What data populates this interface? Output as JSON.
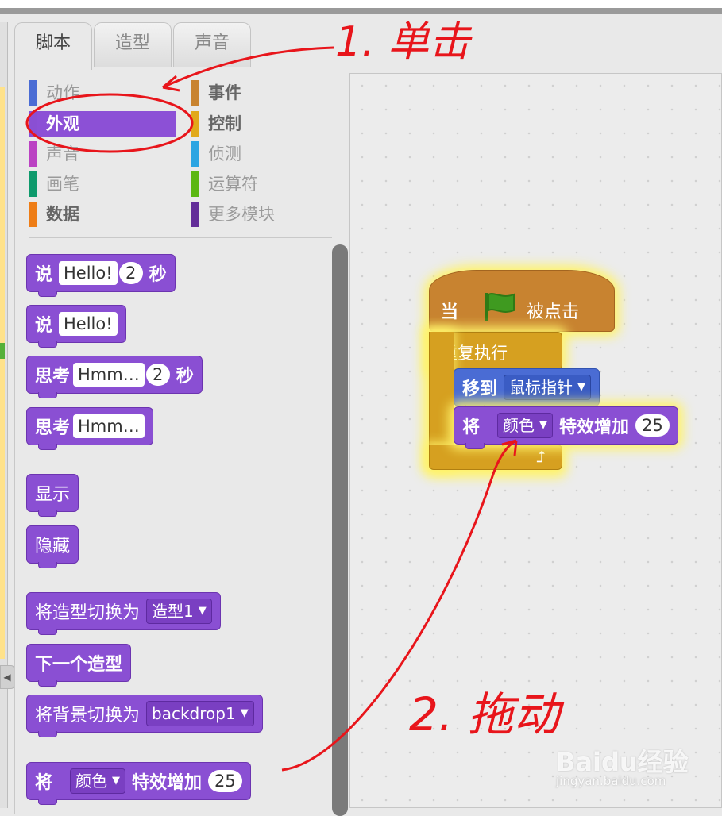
{
  "tabs": [
    "脚本",
    "造型",
    "声音"
  ],
  "categories": {
    "left": [
      {
        "label": "动作",
        "color": "#4a6cd4"
      },
      {
        "label": "外观",
        "color": "#8a4fd3"
      },
      {
        "label": "声音",
        "color": "#bb42c3"
      },
      {
        "label": "画笔",
        "color": "#0e9a6c"
      },
      {
        "label": "数据",
        "color": "#ee7d16"
      }
    ],
    "right": [
      {
        "label": "事件",
        "color": "#c88330"
      },
      {
        "label": "控制",
        "color": "#e1a91a"
      },
      {
        "label": "侦测",
        "color": "#2ca5e2"
      },
      {
        "label": "运算符",
        "color": "#5cb712"
      },
      {
        "label": "更多模块",
        "color": "#632d99"
      }
    ],
    "selected": "外观"
  },
  "palette_blocks": {
    "say_secs": {
      "label": "说",
      "text": "Hello!",
      "secs": "2",
      "unit": "秒"
    },
    "say": {
      "label": "说",
      "text": "Hello!"
    },
    "think_secs": {
      "label": "思考",
      "text": "Hmm…",
      "secs": "2",
      "unit": "秒"
    },
    "think": {
      "label": "思考",
      "text": "Hmm…"
    },
    "show": "显示",
    "hide": "隐藏",
    "switch_costume": {
      "label": "将造型切换为",
      "value": "造型1"
    },
    "next_costume": "下一个造型",
    "switch_backdrop": {
      "label": "将背景切换为",
      "value": "backdrop1"
    },
    "change_effect": {
      "label": "将",
      "effect": "颜色",
      "suffix": "特效增加",
      "value": "25"
    }
  },
  "script": {
    "hat": {
      "prefix": "当",
      "suffix": "被点击",
      "flag_color": "#3f9a20"
    },
    "forever": "重复执行",
    "goto": {
      "label": "移到",
      "target": "鼠标指针"
    },
    "change_effect": {
      "label": "将",
      "effect": "颜色",
      "suffix": "特效增加",
      "value": "25"
    }
  },
  "annotations": {
    "step1": "1. 单击",
    "step2": "2. 拖动",
    "color": "#e8151b"
  },
  "watermark": {
    "logo": "Baidu经验",
    "url": "jingyan.baidu.com"
  }
}
